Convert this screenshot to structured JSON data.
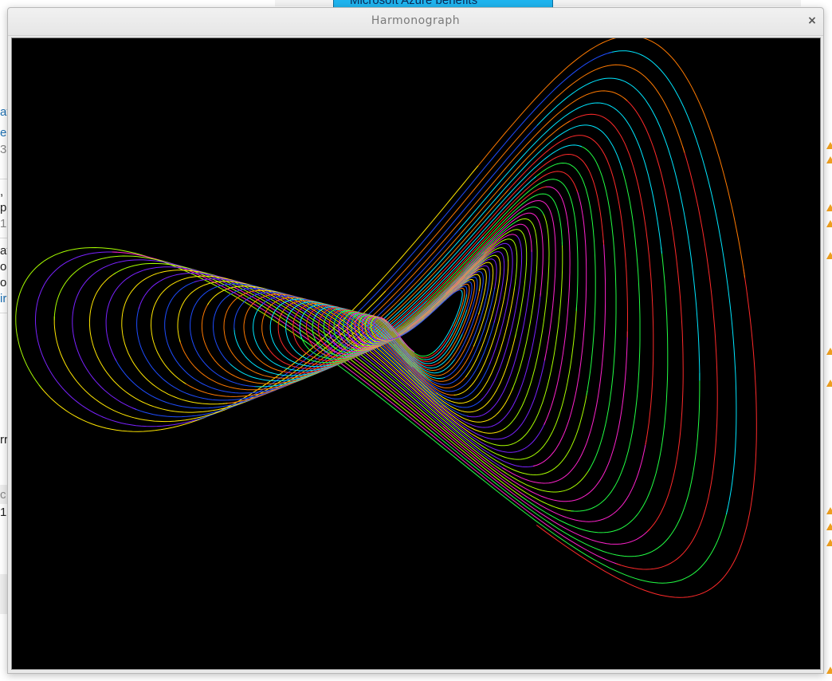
{
  "window": {
    "title": "Harmonograph",
    "close_label": "×"
  },
  "background_page": {
    "top_tab": "Microsoft Azure benefits",
    "fragments": [
      "at",
      "er",
      "3",
      ",",
      "p",
      "1",
      "at",
      "or",
      "o",
      "ir",
      "rr",
      "c",
      "1"
    ]
  },
  "drawing": {
    "background_color": "#000000",
    "curve_colors": [
      "#ff2a2a",
      "#ff7a00",
      "#ffe600",
      "#a8ff00",
      "#22ff44",
      "#00e6ff",
      "#1e4dff",
      "#7a22ff",
      "#ff22cc"
    ]
  }
}
